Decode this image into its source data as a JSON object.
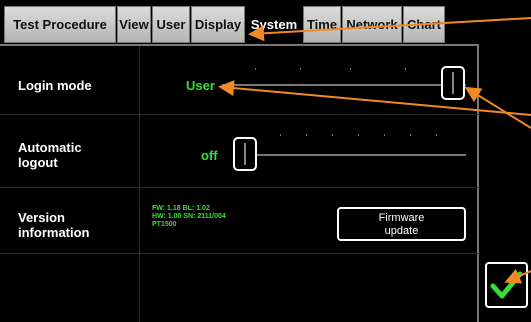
{
  "tabs": [
    {
      "label": "Test Procedure",
      "active": false
    },
    {
      "label": "View",
      "active": false
    },
    {
      "label": "User",
      "active": false
    },
    {
      "label": "Display",
      "active": false
    },
    {
      "label": "System",
      "active": true
    },
    {
      "label": "Time",
      "active": false
    },
    {
      "label": "Network",
      "active": false
    },
    {
      "label": "Chart",
      "active": false
    }
  ],
  "login": {
    "label": "Login mode",
    "value": "User"
  },
  "logout": {
    "label_line1": "Automatic",
    "label_line2": "logout",
    "value": "off"
  },
  "version": {
    "label_line1": "Version",
    "label_line2": "information",
    "line1": "FW: 1.18  BL: 1.02",
    "line2": "HW: 1.00  SN: 2111/004",
    "line3": "PT1500"
  },
  "firmware_button": {
    "line1": "Firmware",
    "line2": "update"
  },
  "confirm_icon": "checkmark-icon",
  "colors": {
    "accent_green": "#35e035",
    "annotation_orange": "#f08a24"
  }
}
